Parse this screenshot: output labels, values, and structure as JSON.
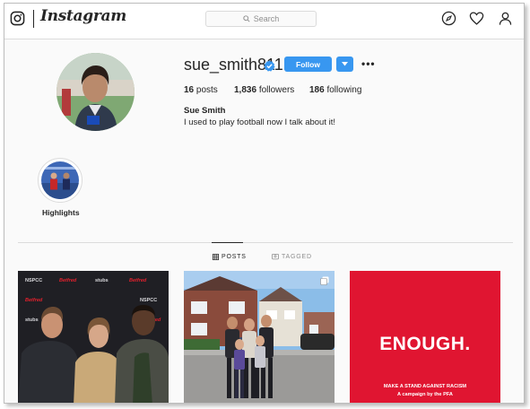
{
  "app": {
    "wordmark": "Instagram"
  },
  "search": {
    "placeholder": "Search"
  },
  "profile": {
    "username": "sue_smith811",
    "follow_label": "Follow",
    "posts_count": "16",
    "posts_label": "posts",
    "followers_count": "1,836",
    "followers_label": "followers",
    "following_count": "186",
    "following_label": "following",
    "full_name": "Sue Smith",
    "bio": "I used to play football now I talk about it!"
  },
  "highlights": [
    {
      "label": "Highlights"
    }
  ],
  "tabs": {
    "posts": "POSTS",
    "tagged": "TAGGED"
  },
  "posts": [
    {
      "type": "photo",
      "banner_texts": [
        "NSPCC",
        "Betfred",
        "stubs"
      ]
    },
    {
      "type": "photo"
    },
    {
      "type": "graphic",
      "headline": "ENOUGH.",
      "line1": "MAKE A STAND AGAINST RACISM",
      "line2": "A campaign by the PFA"
    }
  ],
  "colors": {
    "accent": "#3897f0",
    "post3_bg": "#e01531",
    "text": "#262626",
    "muted": "#8e8e8e"
  },
  "icons": [
    "instagram-glyph-icon",
    "search-icon",
    "compass-icon",
    "heart-icon",
    "user-icon",
    "verified-badge-icon",
    "chevron-down-icon",
    "more-icon",
    "grid-icon",
    "tag-icon",
    "multiple-posts-icon"
  ]
}
